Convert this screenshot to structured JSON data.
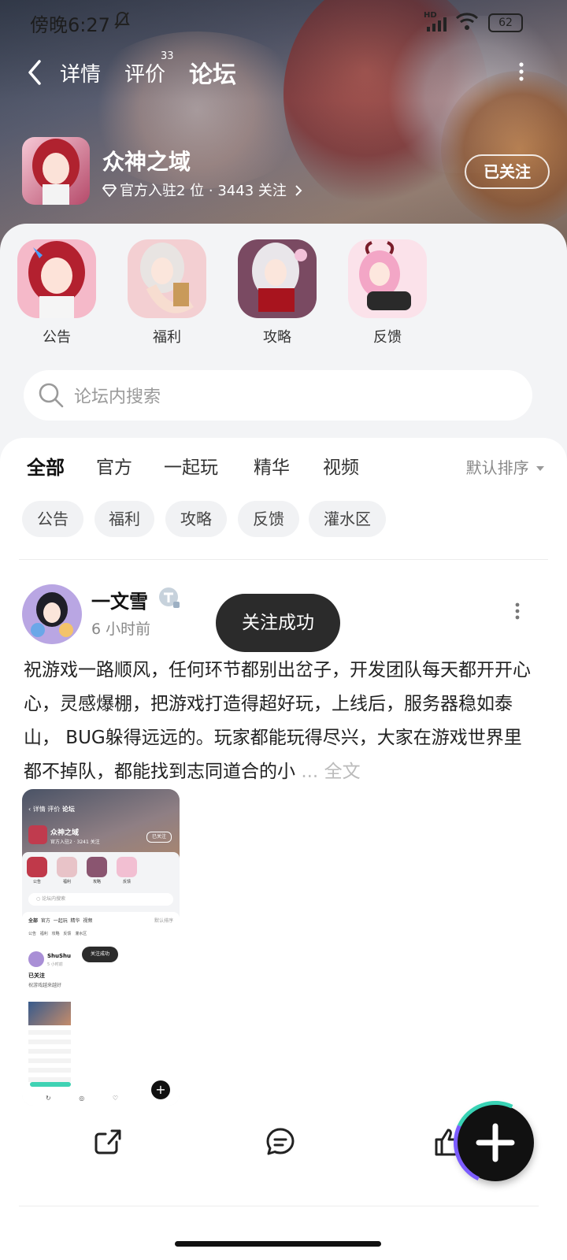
{
  "status": {
    "time": "傍晚6:27",
    "network_badge": "HD",
    "battery": "62"
  },
  "nav": {
    "tabs": [
      {
        "label": "详情"
      },
      {
        "label": "评价",
        "badge": "33"
      },
      {
        "label": "论坛"
      }
    ],
    "active_tab": "论坛"
  },
  "game": {
    "name": "众神之域",
    "meta": "官方入驻2 位 · 3443 关注",
    "follow_label": "已关注"
  },
  "categories": [
    {
      "label": "公告"
    },
    {
      "label": "福利"
    },
    {
      "label": "攻略"
    },
    {
      "label": "反馈"
    }
  ],
  "search": {
    "placeholder": "论坛内搜索"
  },
  "filter_tabs": [
    {
      "label": "全部"
    },
    {
      "label": "官方"
    },
    {
      "label": "一起玩"
    },
    {
      "label": "精华"
    },
    {
      "label": "视频"
    }
  ],
  "sort_label": "默认排序",
  "chips": [
    {
      "label": "公告"
    },
    {
      "label": "福利"
    },
    {
      "label": "攻略"
    },
    {
      "label": "反馈"
    },
    {
      "label": "灌水区"
    }
  ],
  "post": {
    "author": "一文雪",
    "time": "6 小时前",
    "text": "祝游戏一路顺风，任何环节都别出岔子，开发团队每天都开开心心，灵感爆棚，把游戏打造得超好玩，上线后，服务器稳如泰山， BUG躲得远远的。玩家都能玩得尽兴，大家在游戏世界里都不掉队，都能找到志同道合的小",
    "ellipsis": "...",
    "full_text_link": "全文",
    "image": {
      "nav_tabs": [
        "详情",
        "评价",
        "论坛"
      ],
      "game_name": "众神之域",
      "game_meta": "官方入驻2 · 3241 关注",
      "follow_label": "已关注",
      "categories": [
        "公告",
        "福利",
        "攻略",
        "反馈"
      ],
      "search_placeholder": "论坛内搜索",
      "filter_tabs": [
        "全部",
        "官方",
        "一起玩",
        "精华",
        "视频"
      ],
      "sort_label": "默认排序",
      "chips": [
        "公告",
        "福利",
        "攻略",
        "反馈",
        "灌水区"
      ],
      "author": "ShuShu",
      "time": "5 小时前",
      "toast": "关注成功",
      "post_title": "已关注",
      "post_text": "祝游戏越来越好"
    }
  },
  "toast": "关注成功",
  "colors": {
    "accent": "#3fd2b3",
    "toast_bg": "#2b2b2b",
    "sheet_bg": "#f3f4f6"
  }
}
